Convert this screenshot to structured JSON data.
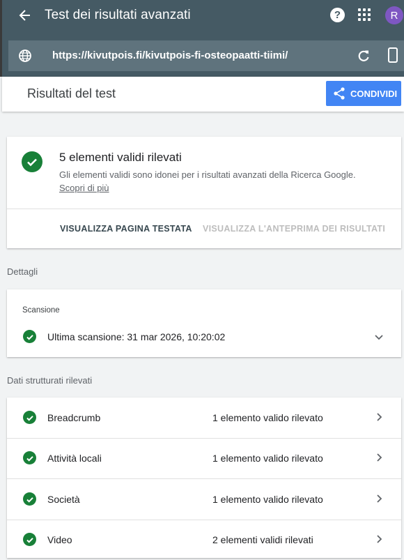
{
  "app": {
    "title": "Test dei risultati avanzati",
    "avatar_letter": "R",
    "help_glyph": "?",
    "accent_color": "#455a64",
    "icons": [
      "back-arrow-icon",
      "help-icon",
      "apps-grid-icon",
      "globe-icon",
      "refresh-icon",
      "smartphone-icon"
    ]
  },
  "urlbar": {
    "url": "https://kivutpois.fi/kivutpois-fi-osteopaatti-tiimi/"
  },
  "results": {
    "title": "Risultati del test",
    "share_label": "CONDIVIDI"
  },
  "summary": {
    "title": "5 elementi validi rilevati",
    "description": "Gli elementi validi sono idonei per i risultati avanzati della Ricerca Google.",
    "learn_more": "Scopri di più",
    "view_page_label": "VISUALIZZA PAGINA TESTATA",
    "preview_label": "VISUALIZZA L'ANTEPRIMA DEI RISULTATI",
    "status_color": "#188038"
  },
  "details": {
    "section_label": "Dettagli",
    "scan_label": "Scansione",
    "scan_text": "Ultima scansione: 31 mar 2026, 10:20:02"
  },
  "structured": {
    "section_label": "Dati strutturati rilevati",
    "items": [
      {
        "name": "Breadcrumb",
        "status": "1 elemento valido rilevato"
      },
      {
        "name": "Attività locali",
        "status": "1 elemento valido rilevato"
      },
      {
        "name": "Società",
        "status": "1 elemento valido rilevato"
      },
      {
        "name": "Video",
        "status": "2 elementi validi rilevati"
      }
    ]
  }
}
